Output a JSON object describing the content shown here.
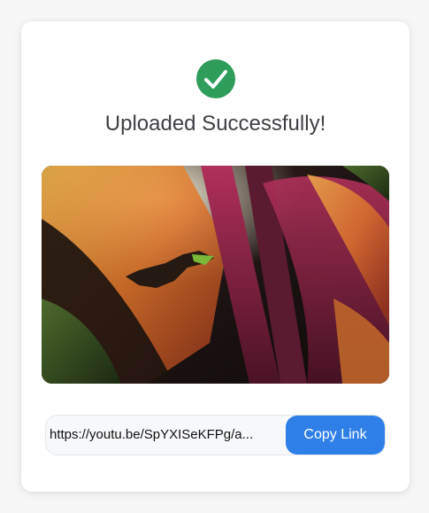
{
  "status": {
    "title": "Uploaded Successfully!",
    "icon": "check-circle-icon",
    "color": "#2e9d5a"
  },
  "image": {
    "description_icon": "photo-leaves-lizard"
  },
  "share": {
    "link_value": "https://youtu.be/SpYXISeKFPg/a...",
    "copy_label": "Copy Link",
    "button_color": "#2f7fe8"
  }
}
